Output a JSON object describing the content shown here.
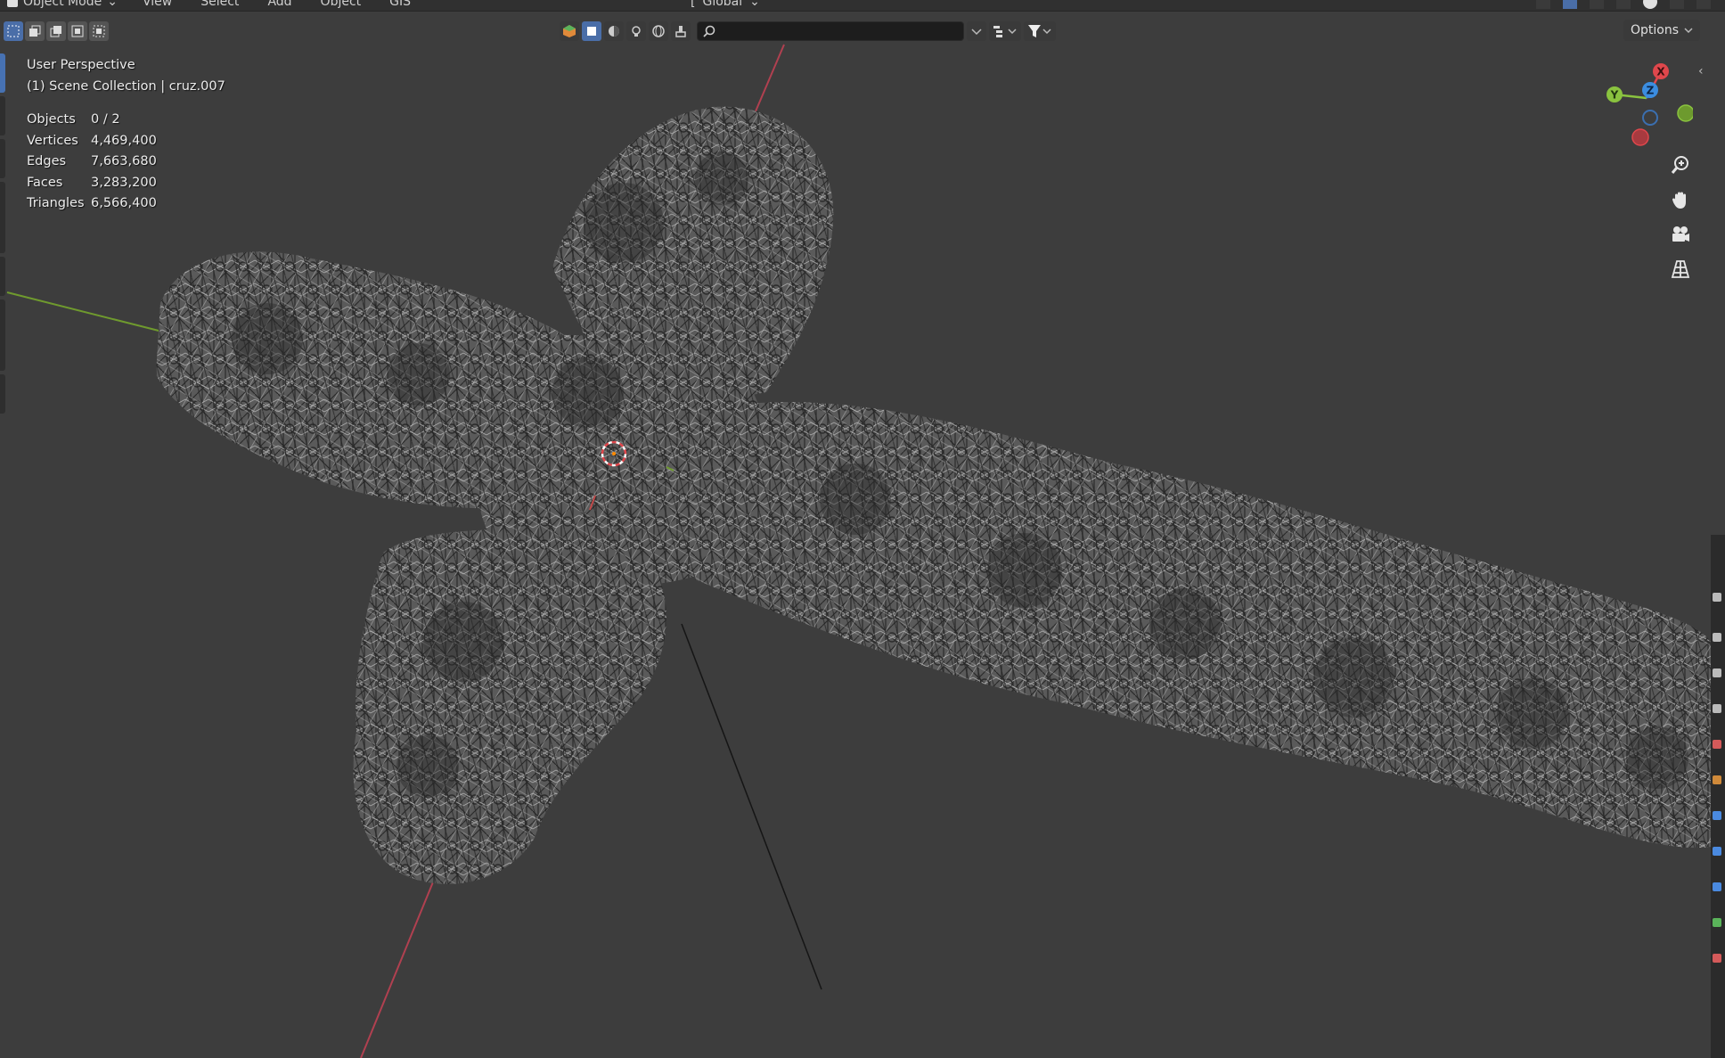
{
  "header": {
    "mode_label": "Object Mode",
    "menus": [
      "View",
      "Select",
      "Add",
      "Object",
      "GIS"
    ],
    "transform_orientation": "Global"
  },
  "toolbar": {
    "search_placeholder": "",
    "options_label": "Options"
  },
  "overlay": {
    "view_name": "User Perspective",
    "collection": "(1) Scene Collection | cruz.007",
    "stats": [
      {
        "label": "Objects",
        "value": "0 / 2"
      },
      {
        "label": "Vertices",
        "value": "4,469,400"
      },
      {
        "label": "Edges",
        "value": "7,663,680"
      },
      {
        "label": "Faces",
        "value": "3,283,200"
      },
      {
        "label": "Triangles",
        "value": "6,566,400"
      }
    ]
  },
  "gizmo": {
    "x_label": "X",
    "y_label": "Y",
    "z_label": "Z"
  },
  "colors": {
    "background": "#3d3d3d",
    "x_axis": "#e0474c",
    "y_axis": "#8ac33f",
    "z_axis": "#3b8de0",
    "selection_blue": "#4a6ea8"
  }
}
